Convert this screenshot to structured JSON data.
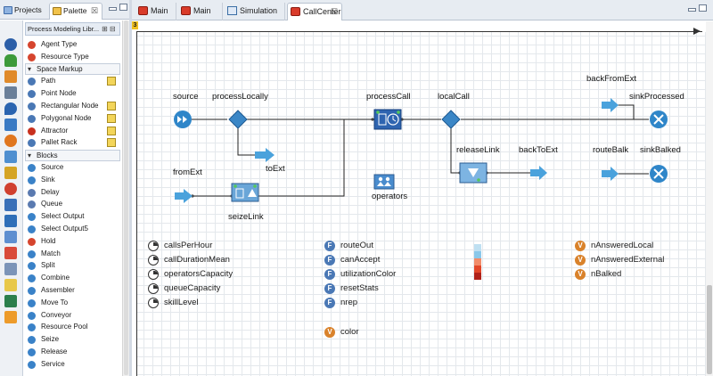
{
  "left_tabs": {
    "projects": "Projects",
    "palette": "Palette",
    "close": "☒"
  },
  "palette": {
    "library": "Process Modeling Libr...",
    "library_buttons": "⊞ ⊟",
    "rows": [
      {
        "label": "Agent Type",
        "icon": "agent-type-icon",
        "color": "#d6452e"
      },
      {
        "label": "Resource Type",
        "icon": "resource-type-icon",
        "color": "#d6452e"
      }
    ],
    "space_markup": {
      "title": "Space Markup",
      "items": [
        {
          "label": "Path",
          "icon": "path-icon",
          "color": "#4a78b5",
          "editable": true
        },
        {
          "label": "Point Node",
          "icon": "point-node-icon",
          "color": "#4a78b5",
          "editable": false
        },
        {
          "label": "Rectangular Node",
          "icon": "rectangular-node-icon",
          "color": "#4a78b5",
          "editable": true
        },
        {
          "label": "Polygonal Node",
          "icon": "polygonal-node-icon",
          "color": "#4a78b5",
          "editable": true
        },
        {
          "label": "Attractor",
          "icon": "attractor-icon",
          "color": "#c8301e",
          "editable": true
        },
        {
          "label": "Pallet Rack",
          "icon": "pallet-rack-icon",
          "color": "#4a78b5",
          "editable": true
        }
      ]
    },
    "blocks": {
      "title": "Blocks",
      "items": [
        {
          "label": "Source",
          "icon": "source-icon",
          "color": "#3a82c8"
        },
        {
          "label": "Sink",
          "icon": "sink-icon",
          "color": "#3a82c8"
        },
        {
          "label": "Delay",
          "icon": "delay-icon",
          "color": "#5a7ab0"
        },
        {
          "label": "Queue",
          "icon": "queue-icon",
          "color": "#5a7ab0"
        },
        {
          "label": "Select Output",
          "icon": "select-output-icon",
          "color": "#3a82c8"
        },
        {
          "label": "Select Output5",
          "icon": "select-output5-icon",
          "color": "#3a82c8"
        },
        {
          "label": "Hold",
          "icon": "hold-icon",
          "color": "#d6452e"
        },
        {
          "label": "Match",
          "icon": "match-icon",
          "color": "#3a82c8"
        },
        {
          "label": "Split",
          "icon": "split-icon",
          "color": "#3a82c8"
        },
        {
          "label": "Combine",
          "icon": "combine-icon",
          "color": "#3a82c8"
        },
        {
          "label": "Assembler",
          "icon": "assembler-icon",
          "color": "#3a82c8"
        },
        {
          "label": "Move To",
          "icon": "move-to-icon",
          "color": "#3a82c8"
        },
        {
          "label": "Conveyor",
          "icon": "conveyor-icon",
          "color": "#3a82c8"
        },
        {
          "label": "Resource Pool",
          "icon": "resource-pool-icon",
          "color": "#3a82c8"
        },
        {
          "label": "Seize",
          "icon": "seize-icon",
          "color": "#3a82c8"
        },
        {
          "label": "Release",
          "icon": "release-icon",
          "color": "#3a82c8"
        },
        {
          "label": "Service",
          "icon": "service-icon",
          "color": "#3a82c8"
        }
      ]
    }
  },
  "editor_tabs": [
    {
      "label": "Main",
      "icon": "agent-icon"
    },
    {
      "label": "Main",
      "icon": "agent-icon"
    },
    {
      "label": "Simulation",
      "icon": "simulation-icon"
    },
    {
      "label": "CallCenter",
      "icon": "agent-icon",
      "active": true
    }
  ],
  "canvas": {
    "zoom_marker": "3",
    "blocks": {
      "source": "source",
      "processLocally": "processLocally",
      "processCall": "processCall",
      "localCall": "localCall",
      "backFromExt": "backFromExt",
      "sinkProcessed": "sinkProcessed",
      "toExt": "toExt",
      "fromExt": "fromExt",
      "seizeLink": "seizeLink",
      "operators": "operators",
      "releaseLink": "releaseLink",
      "backToExt": "backToExt",
      "routeBalk": "routeBalk",
      "sinkBalked": "sinkBalked"
    },
    "parameters": [
      "callsPerHour",
      "callDurationMean",
      "operatorsCapacity",
      "queueCapacity",
      "skillLevel"
    ],
    "functions": [
      "routeOut",
      "canAccept",
      "utilizationColor",
      "resetStats",
      "nrep"
    ],
    "variables_right": [
      "nAnsweredLocal",
      "nAnsweredExternal",
      "nBalked"
    ],
    "variable_color": "color",
    "icon_letters": {
      "function": "F",
      "variable": "V"
    },
    "color_scale": [
      "#bfe0f2",
      "#8ac8ea",
      "#f28c6a",
      "#e2472a",
      "#b0221a"
    ]
  }
}
